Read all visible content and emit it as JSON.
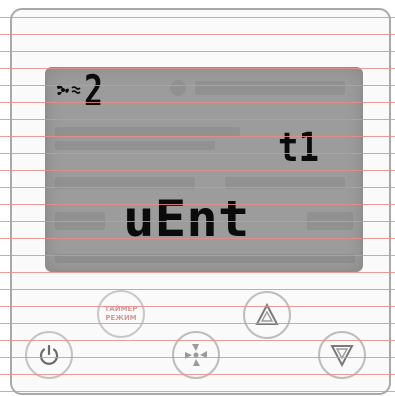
{
  "lcd": {
    "fan_speed_digit": "2",
    "timer_indicator": "t1",
    "mode_text": "uEnt"
  },
  "buttons": {
    "timer_mode_line1": "ТАЙМЕР",
    "timer_mode_line2": "РЕЖИМ"
  },
  "icons": {
    "lcd_fan": "fan-icon",
    "lcd_air": "air-flow-icon",
    "power": "power-icon",
    "fan": "fan-icon",
    "up": "triangle-up-icon",
    "down": "triangle-down-icon"
  },
  "colors": {
    "lcd_background": "#9c9c9c",
    "segment": "#0b0b0b",
    "ruled_lines": "#e88c8c",
    "panel_border": "#a9a9a9"
  }
}
